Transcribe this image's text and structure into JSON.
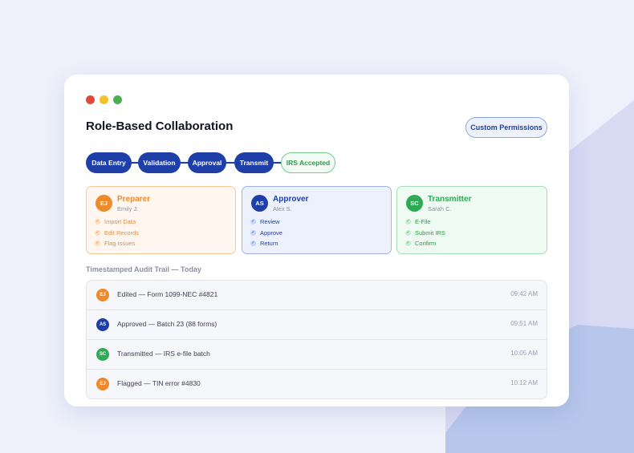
{
  "window": {
    "title": "Role-Based Collaboration",
    "custom_permissions_label": "Custom Permissions"
  },
  "workflow": {
    "steps": [
      "Data Entry",
      "Validation",
      "Approval",
      "Transmit",
      "IRS Accepted"
    ],
    "active_step": "IRS Accepted"
  },
  "roles": [
    {
      "name": "Preparer",
      "initials": "EJ",
      "user": "Emily J.",
      "color": "#ee8a2b",
      "permissions": [
        "Import Data",
        "Edit Records",
        "Flag Issues"
      ]
    },
    {
      "name": "Approver",
      "initials": "AS",
      "user": "Alex S.",
      "color": "#1e3fa8",
      "permissions": [
        "Review",
        "Approve",
        "Return"
      ]
    },
    {
      "name": "Transmitter",
      "initials": "SC",
      "user": "Sarah C.",
      "color": "#2eaa55",
      "permissions": [
        "E-File",
        "Submit IRS",
        "Confirm"
      ]
    }
  ],
  "audit": {
    "heading": "Timestamped Audit Trail — Today",
    "entries": [
      {
        "initials": "EJ",
        "text": "Edited — Form 1099-NEC #4821",
        "time": "09:42 AM"
      },
      {
        "initials": "AS",
        "text": "Approved — Batch 23 (88 forms)",
        "time": "09:51 AM"
      },
      {
        "initials": "SC",
        "text": "Transmitted — IRS e-file batch",
        "time": "10:05 AM"
      },
      {
        "initials": "EJ",
        "text": "Flagged — TIN error #4830",
        "time": "10:12 AM"
      }
    ]
  },
  "colors": {
    "accent": "#1e3fa8",
    "preparer": "#ee8a2b",
    "approver": "#1e3fa8",
    "transmitter": "#2eaa55",
    "success_badge": "#2e9c4c"
  }
}
